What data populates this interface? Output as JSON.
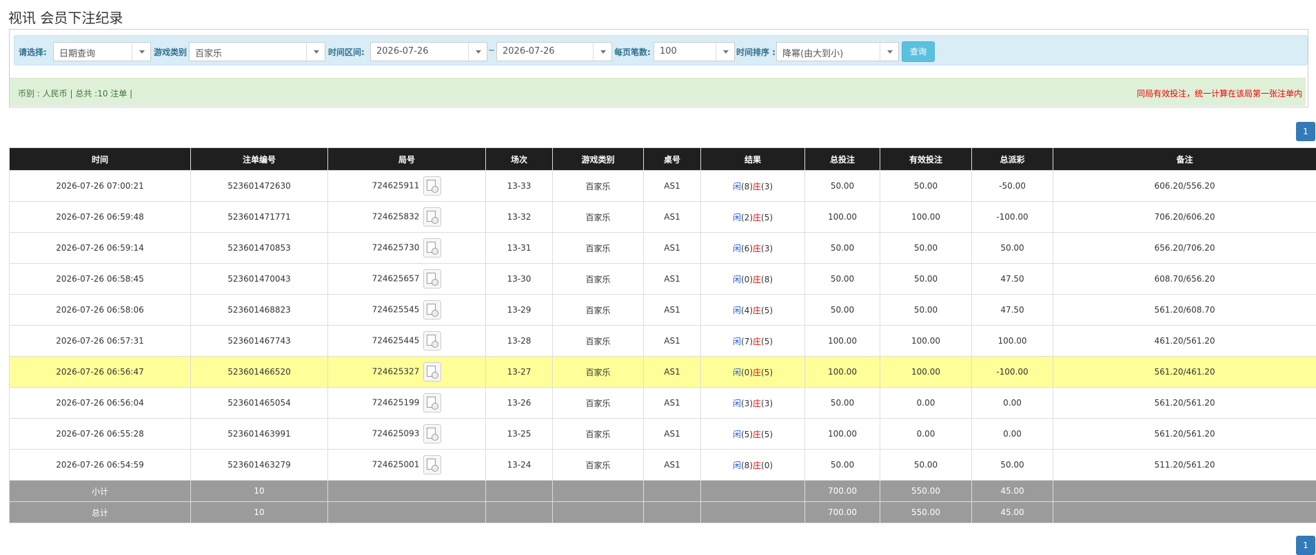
{
  "page": {
    "title": "视讯 会员下注纪录"
  },
  "filters": {
    "select_label": "请选择:",
    "select_value": "日期查询",
    "game_label": "游戏类别",
    "game_value": "百家乐",
    "range_label": "时间区间:",
    "date_from": "2026-07-26",
    "tilde": "~",
    "date_to": "2026-07-26",
    "per_page_label": "每页笔数:",
    "per_page_value": "100",
    "sort_label": "时间排序 :",
    "sort_value": "降幂(由大到小)",
    "query_button": "查询"
  },
  "summary": {
    "left": "币别 : 人民币 | 总共 :10 注单 |",
    "right": "同局有效投注，统一计算在该局第一张注单内"
  },
  "pagination": {
    "current_page": "1"
  },
  "table": {
    "headers": [
      "时间",
      "注单编号",
      "局号",
      "场次",
      "游戏类别",
      "桌号",
      "结果",
      "总投注",
      "有效投注",
      "总派彩",
      "备注"
    ],
    "rows": [
      {
        "time": "2026-07-26 07:00:21",
        "order_no": "523601472630",
        "round_no": "724625911",
        "session": "13-33",
        "game": "百家乐",
        "table": "AS1",
        "player_label": "闲",
        "player": "(8)",
        "banker_label": "庄",
        "banker": "(3)",
        "total_bet": "50.00",
        "valid_bet": "50.00",
        "payout": "-50.00",
        "payout_neg": true,
        "note": "606.20/556.20"
      },
      {
        "time": "2026-07-26 06:59:48",
        "order_no": "523601471771",
        "round_no": "724625832",
        "session": "13-32",
        "game": "百家乐",
        "table": "AS1",
        "player_label": "闲",
        "player": "(2)",
        "banker_label": "庄",
        "banker": "(5)",
        "total_bet": "100.00",
        "valid_bet": "100.00",
        "payout": "-100.00",
        "payout_neg": true,
        "note": "706.20/606.20"
      },
      {
        "time": "2026-07-26 06:59:14",
        "order_no": "523601470853",
        "round_no": "724625730",
        "session": "13-31",
        "game": "百家乐",
        "table": "AS1",
        "player_label": "闲",
        "player": "(6)",
        "banker_label": "庄",
        "banker": "(3)",
        "total_bet": "50.00",
        "valid_bet": "50.00",
        "payout": "50.00",
        "payout_neg": false,
        "note": "656.20/706.20"
      },
      {
        "time": "2026-07-26 06:58:45",
        "order_no": "523601470043",
        "round_no": "724625657",
        "session": "13-30",
        "game": "百家乐",
        "table": "AS1",
        "player_label": "闲",
        "player": "(0)",
        "banker_label": "庄",
        "banker": "(8)",
        "total_bet": "50.00",
        "valid_bet": "50.00",
        "payout": "47.50",
        "payout_neg": false,
        "note": "608.70/656.20"
      },
      {
        "time": "2026-07-26 06:58:06",
        "order_no": "523601468823",
        "round_no": "724625545",
        "session": "13-29",
        "game": "百家乐",
        "table": "AS1",
        "player_label": "闲",
        "player": "(4)",
        "banker_label": "庄",
        "banker": "(5)",
        "total_bet": "50.00",
        "valid_bet": "50.00",
        "payout": "47.50",
        "payout_neg": false,
        "note": "561.20/608.70"
      },
      {
        "time": "2026-07-26 06:57:31",
        "order_no": "523601467743",
        "round_no": "724625445",
        "session": "13-28",
        "game": "百家乐",
        "table": "AS1",
        "player_label": "闲",
        "player": "(7)",
        "banker_label": "庄",
        "banker": "(5)",
        "total_bet": "100.00",
        "valid_bet": "100.00",
        "payout": "100.00",
        "payout_neg": false,
        "note": "461.20/561.20"
      },
      {
        "time": "2026-07-26 06:56:47",
        "order_no": "523601466520",
        "round_no": "724625327",
        "session": "13-27",
        "game": "百家乐",
        "table": "AS1",
        "player_label": "闲",
        "player": "(0)",
        "banker_label": "庄",
        "banker": "(5)",
        "total_bet": "100.00",
        "valid_bet": "100.00",
        "payout": "-100.00",
        "payout_neg": true,
        "note": "561.20/461.20",
        "highlight": true
      },
      {
        "time": "2026-07-26 06:56:04",
        "order_no": "523601465054",
        "round_no": "724625199",
        "session": "13-26",
        "game": "百家乐",
        "table": "AS1",
        "player_label": "闲",
        "player": "(3)",
        "banker_label": "庄",
        "banker": "(3)",
        "total_bet": "50.00",
        "valid_bet": "0.00",
        "payout": "0.00",
        "payout_neg": false,
        "note": "561.20/561.20"
      },
      {
        "time": "2026-07-26 06:55:28",
        "order_no": "523601463991",
        "round_no": "724625093",
        "session": "13-25",
        "game": "百家乐",
        "table": "AS1",
        "player_label": "闲",
        "player": "(5)",
        "banker_label": "庄",
        "banker": "(5)",
        "total_bet": "100.00",
        "valid_bet": "0.00",
        "payout": "0.00",
        "payout_neg": false,
        "note": "561.20/561.20"
      },
      {
        "time": "2026-07-26 06:54:59",
        "order_no": "523601463279",
        "round_no": "724625001",
        "session": "13-24",
        "game": "百家乐",
        "table": "AS1",
        "player_label": "闲",
        "player": "(8)",
        "banker_label": "庄",
        "banker": "(0)",
        "total_bet": "50.00",
        "valid_bet": "50.00",
        "payout": "50.00",
        "payout_neg": false,
        "note": "511.20/561.20"
      }
    ],
    "subtotal": {
      "label": "小计",
      "count": "10",
      "total_bet": "700.00",
      "valid_bet": "550.00",
      "payout": "45.00"
    },
    "grand_total": {
      "label": "总计",
      "count": "10",
      "total_bet": "700.00",
      "valid_bet": "550.00",
      "payout": "45.00"
    }
  }
}
